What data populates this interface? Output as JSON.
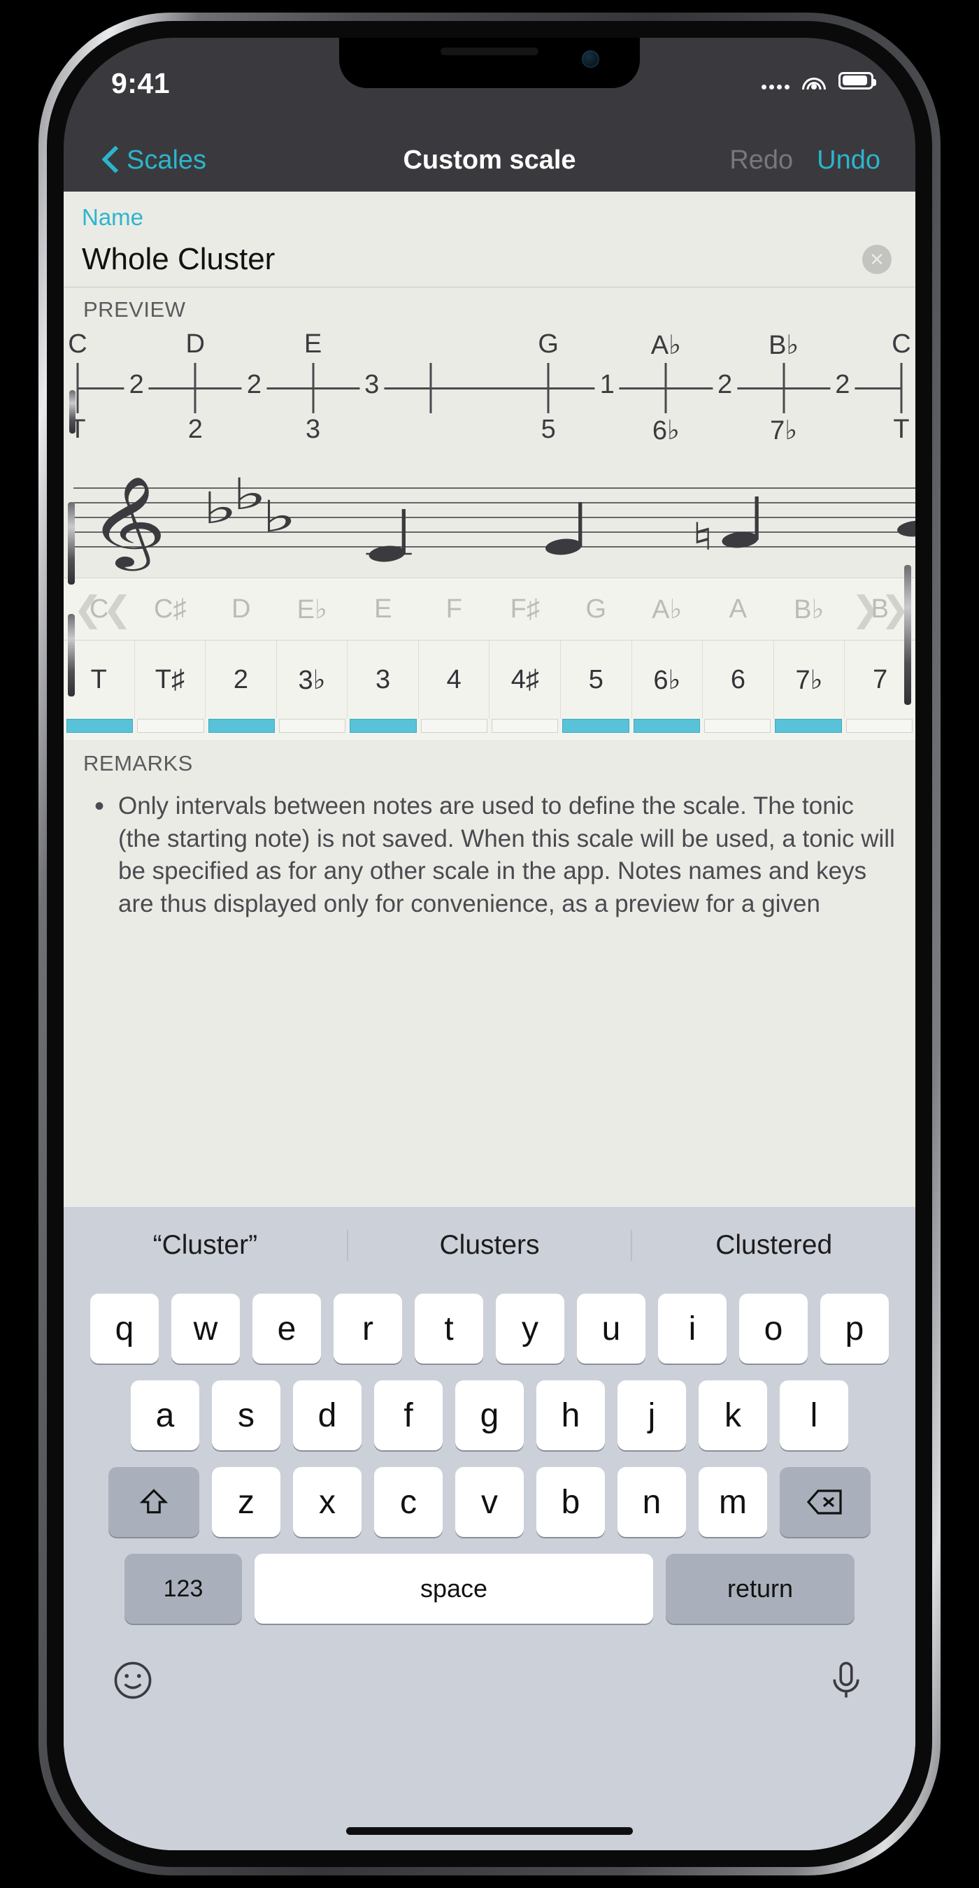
{
  "status_bar": {
    "time": "9:41",
    "signal_icon": "signal-dots-icon",
    "wifi_icon": "wifi-icon",
    "battery_icon": "battery-icon"
  },
  "nav": {
    "back_label": "Scales",
    "back_icon": "chevron-left-icon",
    "title": "Custom scale",
    "redo_label": "Redo",
    "undo_label": "Undo"
  },
  "name_section": {
    "label": "Name",
    "value": "Whole Cluster",
    "clear_icon": "clear-circle-icon",
    "clear_glyph": "✕"
  },
  "preview": {
    "title": "PREVIEW",
    "notes": [
      "C",
      "D",
      "E",
      "",
      "G",
      "A♭",
      "B♭",
      "C"
    ],
    "degrees": [
      "T",
      "2",
      "3",
      "",
      "5",
      "6♭",
      "7♭",
      "T"
    ],
    "intervals": [
      "2",
      "2",
      "3",
      "1",
      "2",
      "2"
    ],
    "interval_positions": [
      0,
      1,
      2,
      4,
      5,
      6
    ],
    "staff": {
      "clef": "treble-clef",
      "key_signature_flats": 3,
      "note_count": 7
    }
  },
  "note_picker": {
    "left_arrow_icon": "chevron-double-left-icon",
    "right_arrow_icon": "chevron-double-right-icon",
    "notes": [
      "C",
      "C♯",
      "D",
      "E♭",
      "E",
      "F",
      "F♯",
      "G",
      "A♭",
      "A",
      "B♭",
      "B"
    ]
  },
  "degree_picker": {
    "degrees": [
      "T",
      "T♯",
      "2",
      "3♭",
      "3",
      "4",
      "4♯",
      "5",
      "6♭",
      "6",
      "7♭",
      "7"
    ],
    "selected": [
      true,
      false,
      true,
      false,
      true,
      false,
      false,
      true,
      true,
      false,
      true,
      false
    ],
    "accent_color": "#58c3d8"
  },
  "remarks": {
    "title": "REMARKS",
    "items": [
      "Only intervals between notes are used to define the scale. The tonic (the starting note) is not saved. When this scale will be used, a tonic will be specified as for any other scale in the app. Notes names and keys are thus displayed only for convenience, as a preview for a given"
    ]
  },
  "keyboard": {
    "suggestions": [
      "“Cluster”",
      "Clusters",
      "Clustered"
    ],
    "row1": [
      "q",
      "w",
      "e",
      "r",
      "t",
      "y",
      "u",
      "i",
      "o",
      "p"
    ],
    "row2": [
      "a",
      "s",
      "d",
      "f",
      "g",
      "h",
      "j",
      "k",
      "l"
    ],
    "row3": [
      "z",
      "x",
      "c",
      "v",
      "b",
      "n",
      "m"
    ],
    "shift_icon": "shift-up-icon",
    "backspace_icon": "backspace-icon",
    "numbers_label": "123",
    "space_label": "space",
    "return_label": "return",
    "emoji_icon": "emoji-smiley-icon",
    "mic_icon": "microphone-icon"
  }
}
